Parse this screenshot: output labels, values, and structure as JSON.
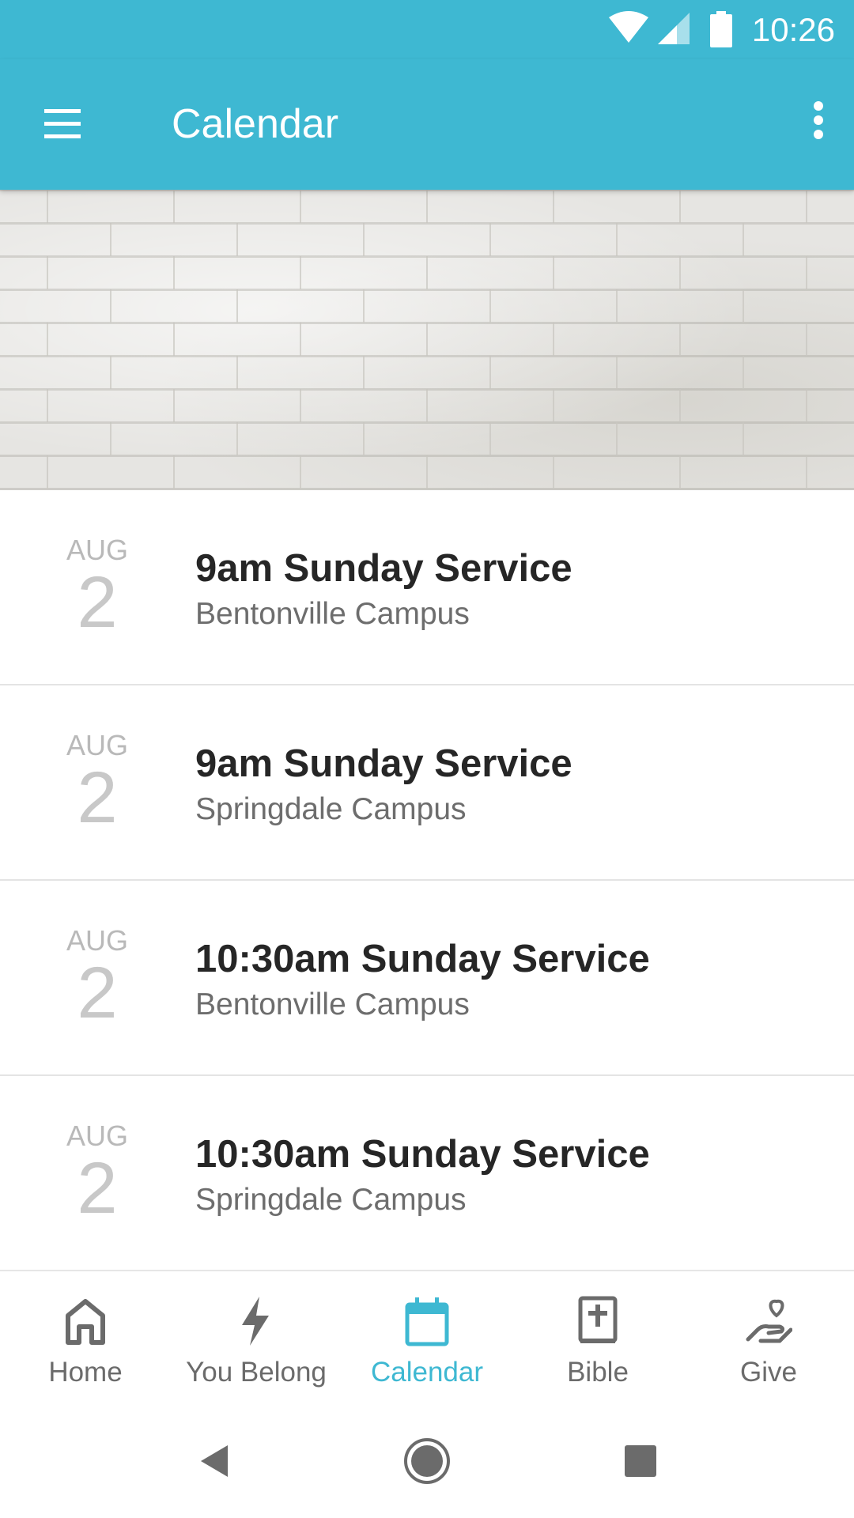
{
  "status_bar": {
    "time": "10:26"
  },
  "app_bar": {
    "title": "Calendar",
    "menu_icon": "hamburger-menu-icon",
    "more_icon": "more-vert-icon"
  },
  "hero": {
    "image": "white-brick-wall-banner"
  },
  "events": [
    {
      "month": "AUG",
      "day": "2",
      "title": "9am Sunday Service",
      "campus": "Bentonville Campus"
    },
    {
      "month": "AUG",
      "day": "2",
      "title": "9am Sunday Service",
      "campus": "Springdale Campus"
    },
    {
      "month": "AUG",
      "day": "2",
      "title": "10:30am Sunday Service",
      "campus": "Bentonville Campus"
    },
    {
      "month": "AUG",
      "day": "2",
      "title": "10:30am Sunday Service",
      "campus": "Springdale Campus"
    }
  ],
  "bottom_nav": [
    {
      "label": "Home",
      "icon": "home-icon",
      "active": false
    },
    {
      "label": "You Belong",
      "icon": "lightning-icon",
      "active": false
    },
    {
      "label": "Calendar",
      "icon": "calendar-icon",
      "active": true
    },
    {
      "label": "Bible",
      "icon": "bible-icon",
      "active": false
    },
    {
      "label": "Give",
      "icon": "give-heart-hand-icon",
      "active": false
    }
  ],
  "colors": {
    "accent": "#3eb8d2",
    "inactive": "#6b6b6b",
    "title_text": "#262626",
    "subtitle_text": "#6d6d6d"
  }
}
